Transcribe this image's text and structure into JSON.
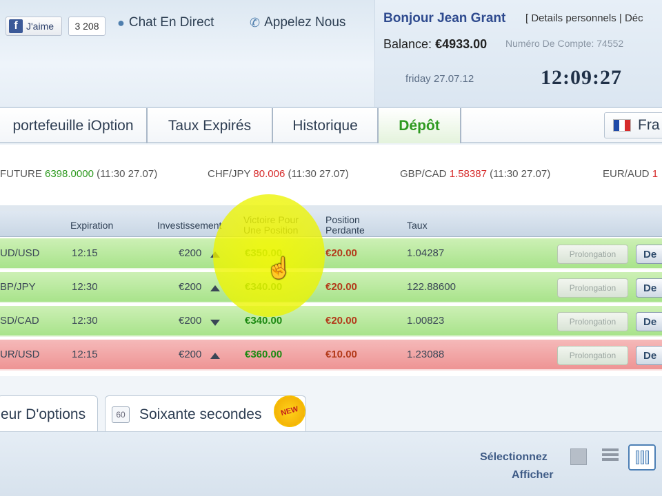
{
  "header": {
    "fb_like_label": "J'aime",
    "fb_count": "3 208",
    "chat_label": "Chat En Direct",
    "call_label": "Appelez Nous"
  },
  "account": {
    "greeting": "Bonjour Jean Grant",
    "links": "[ Details personnels  |  Déc",
    "balance_label": "Balance:",
    "balance_value": "€4933.00",
    "account_number": "Numéro De Compte: 74552",
    "date": "friday 27.07.12",
    "time": "12:09:27"
  },
  "tabs": [
    {
      "label": "portefeuille iOption",
      "active": false
    },
    {
      "label": "Taux Expirés",
      "active": false
    },
    {
      "label": "Historique",
      "active": false
    },
    {
      "label": "Dépôt",
      "active": true
    }
  ],
  "language": {
    "label": "Fra"
  },
  "ticker": [
    {
      "symbol": "FUTURE",
      "value": "6398.0000",
      "value_color": "green",
      "time": "(11:30 27.07)"
    },
    {
      "symbol": "CHF/JPY",
      "value": "80.006",
      "value_color": "red",
      "time": "(11:30 27.07)"
    },
    {
      "symbol": "GBP/CAD",
      "value": "1.58387",
      "value_color": "red",
      "time": "(11:30 27.07)"
    },
    {
      "symbol": "EUR/AUD",
      "value": "1",
      "value_color": "red",
      "time": ""
    }
  ],
  "table": {
    "headers": {
      "expiration": "Expiration",
      "investment": "Investissement",
      "win_line1": "Victoire Pour",
      "win_line2": "Une Position",
      "lose_line1": "Position",
      "lose_line2": "Perdante",
      "rate": "Taux"
    },
    "rows": [
      {
        "asset": "UD/USD",
        "expiration": "12:15",
        "investment": "€200",
        "direction": "up",
        "win": "€350.00",
        "lose": "€20.00",
        "rate": "1.04287",
        "status": "green",
        "prolong": "Prolongation",
        "action": "De"
      },
      {
        "asset": "BP/JPY",
        "expiration": "12:30",
        "investment": "€200",
        "direction": "up",
        "win": "€340.00",
        "lose": "€20.00",
        "rate": "122.88600",
        "status": "green",
        "prolong": "Prolongation",
        "action": "De"
      },
      {
        "asset": "SD/CAD",
        "expiration": "12:30",
        "investment": "€200",
        "direction": "down",
        "win": "€340.00",
        "lose": "€20.00",
        "rate": "1.00823",
        "status": "green",
        "prolong": "Prolongation",
        "action": "De"
      },
      {
        "asset": "UR/USD",
        "expiration": "12:15",
        "investment": "€200",
        "direction": "up",
        "win": "€360.00",
        "lose": "€10.00",
        "rate": "1.23088",
        "status": "red",
        "prolong": "Prolongation",
        "action": "De"
      }
    ]
  },
  "bottom_tabs": {
    "options_label": "eur D'options",
    "sixty_badge": "60",
    "sixty_label": "Soixante secondes",
    "new_badge": "NEW"
  },
  "view_options": {
    "select_label": "Sélectionnez",
    "display_label": "Afficher"
  },
  "colors": {
    "win_green": "#1d8a12",
    "lose_red": "#b33a1a",
    "active_tab": "#2e9a20",
    "brand_blue": "#2f4b8f"
  }
}
